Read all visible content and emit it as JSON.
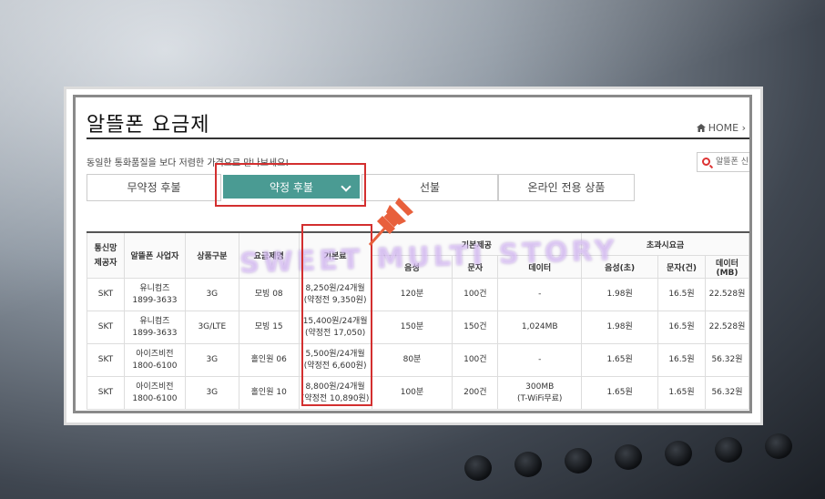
{
  "page": {
    "title": "알뜰폰 요금제",
    "home_label": "HOME",
    "home_chevron": "›",
    "subtitle": "동일한 통화품질을 보다 저렴한 가격으로 만나보세요!",
    "search_placeholder": "알뜰폰 신"
  },
  "tabs": [
    {
      "label": "무약정 후불",
      "active": false
    },
    {
      "label": "약정 후불",
      "active": true
    },
    {
      "label": "선불",
      "active": false
    },
    {
      "label": "온라인 전용 상품",
      "active": false
    }
  ],
  "watermark": "SWEET MULTI STORY",
  "table": {
    "headers": {
      "carrier": "통신망\n제공자",
      "provider": "알뜰폰 사업자",
      "type": "상품구분",
      "plan": "요금제명",
      "base_fee": "기본료",
      "basic": "기본제공",
      "overage": "초과시요금",
      "voice": "음성",
      "sms": "문자",
      "data": "데이터",
      "voice_over": "음성(초)",
      "sms_over": "문자(건)",
      "data_over": "데이터(MB)"
    },
    "rows": [
      {
        "carrier": "SKT",
        "provider": "유니컴즈",
        "phone": "1899-3633",
        "type": "3G",
        "plan": "모빙 08",
        "fee": "8,250원/24개월",
        "fee_before": "(약정전 9,350원)",
        "voice": "120분",
        "sms": "100건",
        "data": "-",
        "data2": "",
        "voice_over": "1.98원",
        "sms_over": "16.5원",
        "data_over": "22.528원"
      },
      {
        "carrier": "SKT",
        "provider": "유니컴즈",
        "phone": "1899-3633",
        "type": "3G/LTE",
        "plan": "모빙 15",
        "fee": "15,400원/24개월",
        "fee_before": "(약정전 17,050)",
        "voice": "150분",
        "sms": "150건",
        "data": "1,024MB",
        "data2": "",
        "voice_over": "1.98원",
        "sms_over": "16.5원",
        "data_over": "22.528원"
      },
      {
        "carrier": "SKT",
        "provider": "아이즈비전",
        "phone": "1800-6100",
        "type": "3G",
        "plan": "홀인원 06",
        "fee": "5,500원/24개월",
        "fee_before": "(약정전 6,600원)",
        "voice": "80분",
        "sms": "100건",
        "data": "-",
        "data2": "",
        "voice_over": "1.65원",
        "sms_over": "16.5원",
        "data_over": "56.32원"
      },
      {
        "carrier": "SKT",
        "provider": "아이즈비전",
        "phone": "1800-6100",
        "type": "3G",
        "plan": "홀인원 10",
        "fee": "8,800원/24개월",
        "fee_before": "(약정전 10,890원)",
        "voice": "100분",
        "sms": "200건",
        "data": "300MB",
        "data2": "(T-WiFi무료)",
        "voice_over": "1.65원",
        "sms_over": "1.65원",
        "data_over": "56.32원"
      }
    ]
  },
  "colors": {
    "accent": "#4a9b93",
    "highlight": "#d32f2f",
    "pin": "#e8603c"
  }
}
